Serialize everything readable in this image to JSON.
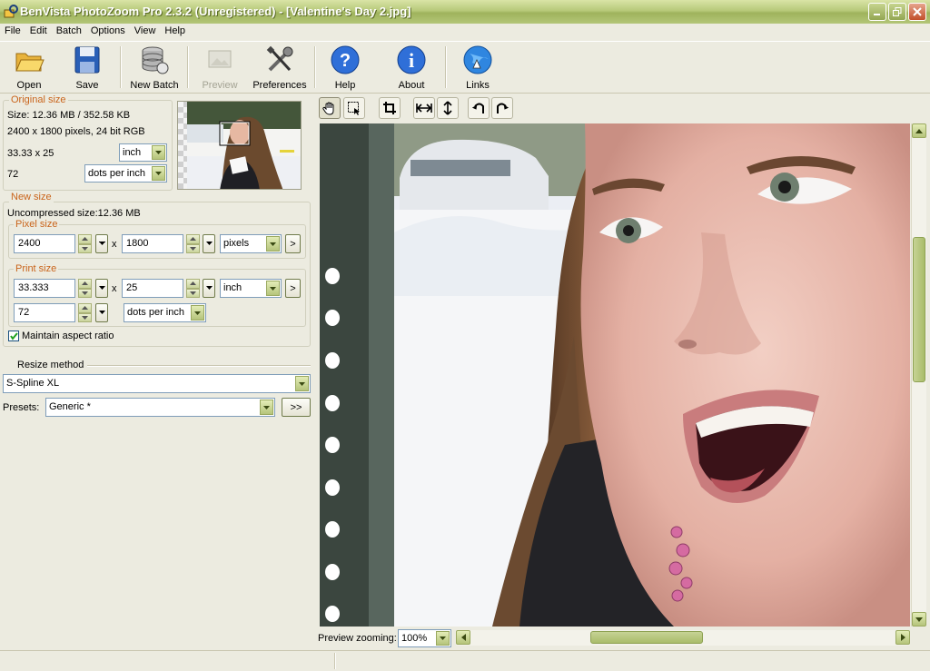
{
  "window": {
    "title": "BenVista PhotoZoom Pro 2.3.2 (Unregistered) - [Valentine's Day 2.jpg]"
  },
  "menu": [
    "File",
    "Edit",
    "Batch",
    "Options",
    "View",
    "Help"
  ],
  "toolbar": {
    "open": "Open",
    "save": "Save",
    "new_batch": "New Batch",
    "preview": "Preview",
    "preferences": "Preferences",
    "help": "Help",
    "about": "About",
    "links": "Links"
  },
  "original_size": {
    "title": "Original size",
    "size_line": "Size: 12.36 MB / 352.58 KB",
    "pixels_line": "2400 x 1800 pixels, 24 bit RGB",
    "dimensions": "33.33 x 25",
    "unit": "inch",
    "resolution": "72",
    "resolution_unit": "dots per inch"
  },
  "new_size": {
    "title": "New size",
    "uncompressed": "Uncompressed size:12.36 MB",
    "pixel_size": {
      "title": "Pixel size",
      "width": "2400",
      "height": "1800",
      "unit": "pixels",
      "times": "x",
      "more": ">"
    },
    "print_size": {
      "title": "Print size",
      "width": "33.333",
      "height": "25",
      "unit": "inch",
      "times": "x",
      "more": ">",
      "resolution": "72",
      "resolution_unit": "dots per inch"
    },
    "maintain_aspect": "Maintain aspect ratio"
  },
  "resize": {
    "title": "Resize method",
    "method": "S-Spline XL",
    "presets_label": "Presets:",
    "preset": "Generic *",
    "presets_button": ">>"
  },
  "preview": {
    "zoom_label": "Preview zooming:",
    "zoom": "100%"
  }
}
